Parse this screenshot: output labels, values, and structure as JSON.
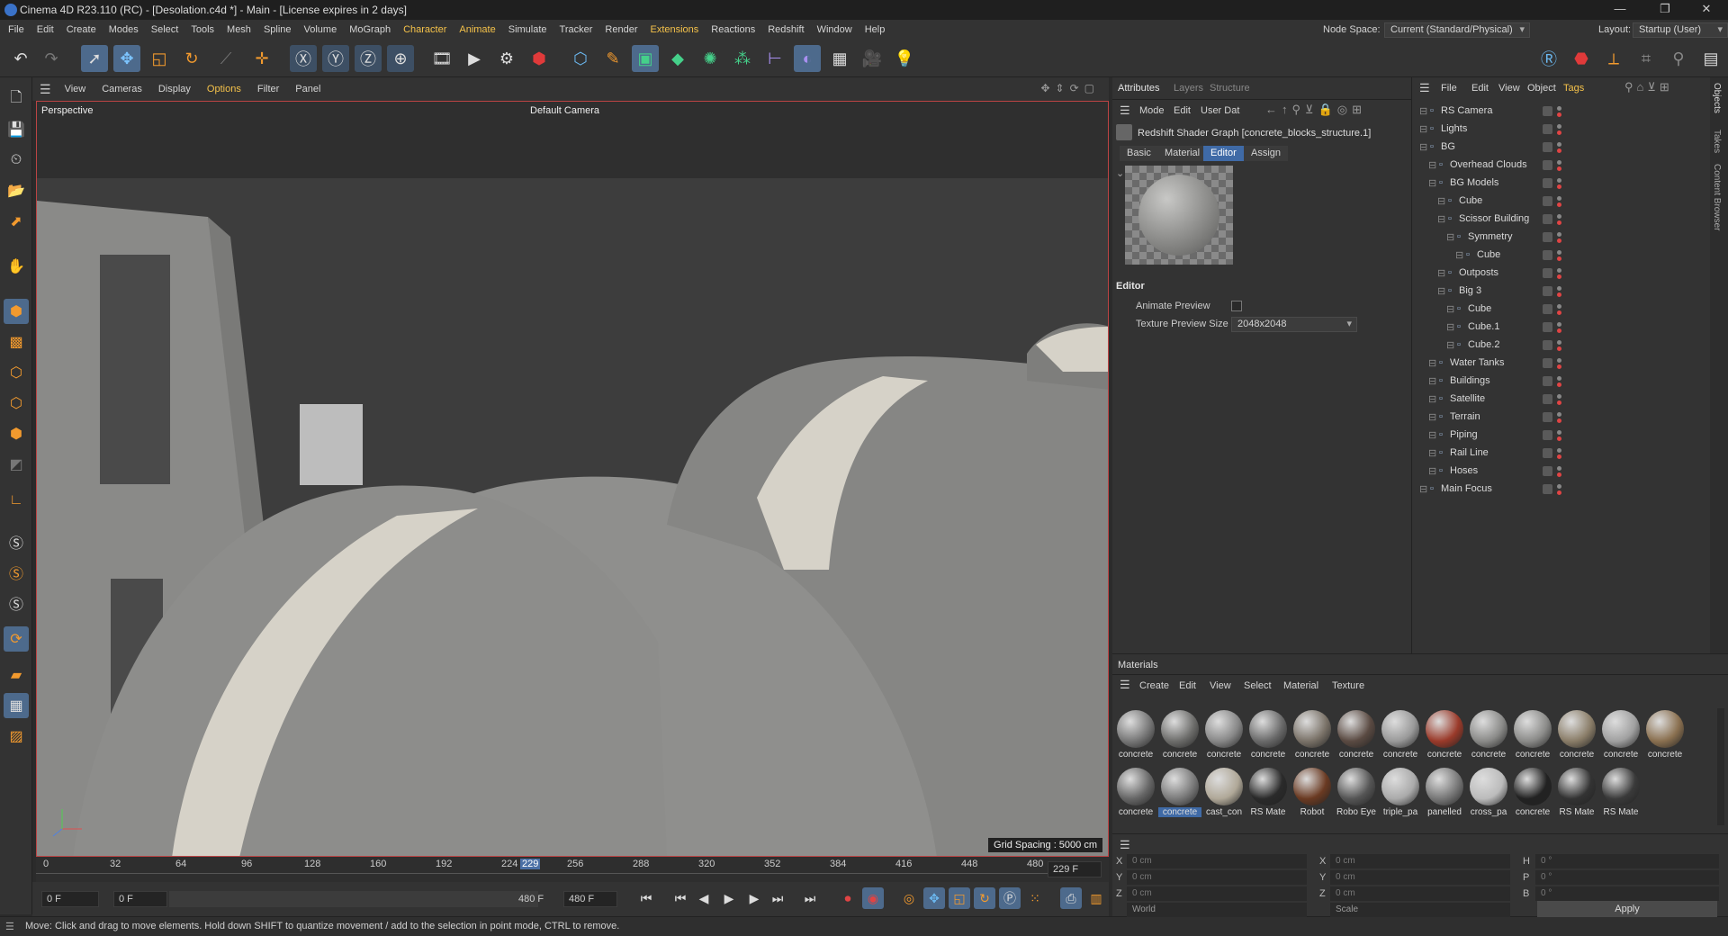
{
  "title": "Cinema 4D R23.110 (RC) - [Desolation.c4d *] - Main - [License expires in 2 days]",
  "window_controls": {
    "minimize": "—",
    "restore": "❐",
    "close": "✕"
  },
  "menu": [
    "File",
    "Edit",
    "Create",
    "Modes",
    "Select",
    "Tools",
    "Mesh",
    "Spline",
    "Volume",
    "MoGraph",
    "Character",
    "Animate",
    "Simulate",
    "Tracker",
    "Render",
    "Extensions",
    "Reactions",
    "Redshift",
    "Window",
    "Help"
  ],
  "menu_accent": [
    "Character",
    "Animate",
    "Extensions"
  ],
  "node_space": {
    "label": "Node Space:",
    "value": "Current (Standard/Physical)"
  },
  "layout": {
    "label": "Layout:",
    "value": "Startup (User)"
  },
  "viewport_menu": [
    "View",
    "Cameras",
    "Display",
    "Options",
    "Filter",
    "Panel"
  ],
  "viewport": {
    "label": "Perspective",
    "camera": "Default Camera",
    "grid_spacing": "Grid Spacing : 5000 cm"
  },
  "timeline": {
    "ticks": [
      "0",
      "32",
      "64",
      "96",
      "128",
      "160",
      "192",
      "224",
      "229",
      "256",
      "288",
      "320",
      "352",
      "384",
      "416",
      "448",
      "480"
    ],
    "current": "229 F"
  },
  "transport": {
    "start": "0 F",
    "start2": "0 F",
    "end": "480 F",
    "end2": "480 F"
  },
  "status": "Move: Click and drag to move elements. Hold down SHIFT to quantize movement / add to the selection in point mode, CTRL to remove.",
  "attributes": {
    "tabs": [
      "Attributes",
      "Layers",
      "Structure"
    ],
    "menu": [
      "Mode",
      "Edit",
      "User Dat"
    ],
    "object_name": "Redshift Shader Graph [concrete_blocks_structure.1]",
    "subtabs": [
      "Basic",
      "Material",
      "Editor",
      "Assign"
    ],
    "section": "Editor",
    "animate_preview": "Animate Preview",
    "texture_preview_label": "Texture Preview Size",
    "texture_preview_value": "2048x2048"
  },
  "objects": {
    "menu": [
      "File",
      "Edit",
      "View",
      "Object",
      "Tags"
    ],
    "side_tabs": [
      "Objects",
      "Takes",
      "Content Browser"
    ],
    "rows": [
      {
        "label": "RS Camera",
        "indent": 0
      },
      {
        "label": "Lights",
        "indent": 0
      },
      {
        "label": "BG",
        "indent": 0
      },
      {
        "label": "Overhead Clouds",
        "indent": 1
      },
      {
        "label": "BG Models",
        "indent": 1
      },
      {
        "label": "Cube",
        "indent": 2
      },
      {
        "label": "Scissor Building",
        "indent": 2
      },
      {
        "label": "Symmetry",
        "indent": 3
      },
      {
        "label": "Cube",
        "indent": 4
      },
      {
        "label": "Outposts",
        "indent": 2
      },
      {
        "label": "Big 3",
        "indent": 2
      },
      {
        "label": "Cube",
        "indent": 3
      },
      {
        "label": "Cube.1",
        "indent": 3
      },
      {
        "label": "Cube.2",
        "indent": 3
      },
      {
        "label": "Water Tanks",
        "indent": 1
      },
      {
        "label": "Buildings",
        "indent": 1
      },
      {
        "label": "Satellite",
        "indent": 1
      },
      {
        "label": "Terrain",
        "indent": 1
      },
      {
        "label": "Piping",
        "indent": 1
      },
      {
        "label": "Rail Line",
        "indent": 1
      },
      {
        "label": "Hoses",
        "indent": 1
      },
      {
        "label": "Main Focus",
        "indent": 0
      }
    ]
  },
  "materials": {
    "title": "Materials",
    "menu": [
      "Create",
      "Edit",
      "View",
      "Select",
      "Material",
      "Texture"
    ],
    "row1": [
      "concrete",
      "concrete",
      "concrete",
      "concrete",
      "concrete",
      "concrete",
      "concrete",
      "concrete",
      "concrete",
      "concrete",
      "concrete",
      "concrete",
      "concrete"
    ],
    "row2": [
      "concrete",
      "concrete",
      "cast_con",
      "RS Mate",
      "Robot",
      "Robo Eye",
      "triple_pa",
      "panelled",
      "cross_pa",
      "concrete",
      "RS Mate",
      "RS Mate"
    ]
  },
  "coords": {
    "labels": [
      "X",
      "Y",
      "Z",
      "X",
      "Y",
      "Z",
      "H",
      "P",
      "B"
    ],
    "pos": [
      "0 cm",
      "0 cm",
      "0 cm"
    ],
    "size": [
      "0 cm",
      "0 cm",
      "0 cm"
    ],
    "rot": [
      "0 °",
      "0 °",
      "0 °"
    ],
    "world": "World",
    "scale": "Scale",
    "apply": "Apply"
  }
}
